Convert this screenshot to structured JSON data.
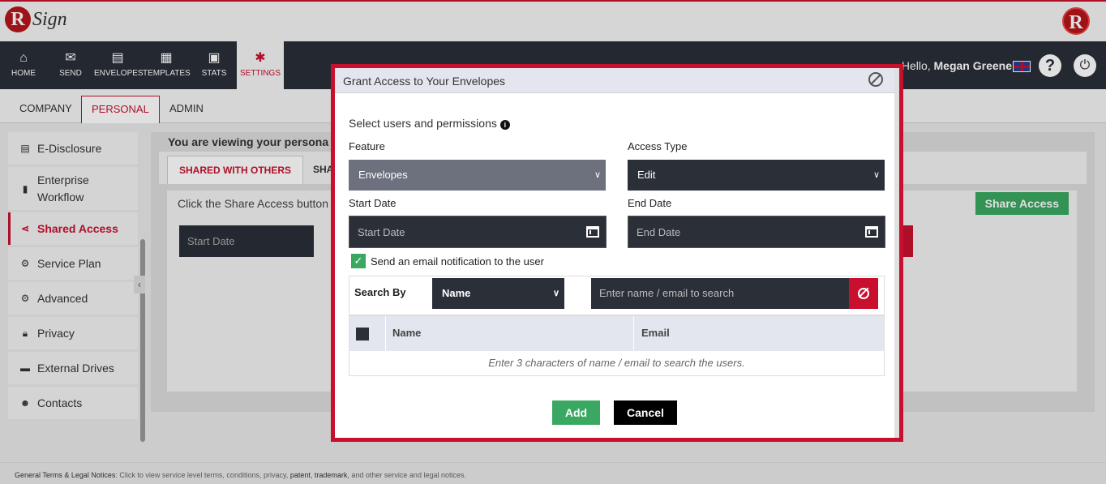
{
  "app": {
    "logo_letter": "R",
    "logo_text": "Sign"
  },
  "nav": {
    "items": [
      {
        "label": "HOME",
        "icon": "home-icon"
      },
      {
        "label": "SEND",
        "icon": "envelope-icon"
      },
      {
        "label": "ENVELOPES",
        "icon": "envelopes-icon"
      },
      {
        "label": "TEMPLATES",
        "icon": "templates-icon"
      },
      {
        "label": "STATS",
        "icon": "briefcase-icon"
      },
      {
        "label": "SETTINGS",
        "icon": "gear-icon"
      }
    ],
    "hello_prefix": "Hello,",
    "user_name": "Megan Greene",
    "help": "?",
    "power": "⏻"
  },
  "subtabs": [
    "COMPANY",
    "PERSONAL",
    "ADMIN"
  ],
  "sidebar": {
    "items": [
      {
        "label": "E-Disclosure",
        "icon": "document-icon"
      },
      {
        "label": "Enterprise Workflow",
        "icon": "file-icon"
      },
      {
        "label": "Shared Access",
        "icon": "share-icon"
      },
      {
        "label": "Service Plan",
        "icon": "cogs-icon"
      },
      {
        "label": "Advanced",
        "icon": "gears-icon"
      },
      {
        "label": "Privacy",
        "icon": "lock-icon"
      },
      {
        "label": "External Drives",
        "icon": "drive-icon"
      },
      {
        "label": "Contacts",
        "icon": "users-icon"
      }
    ]
  },
  "main": {
    "title": "You are viewing your persona",
    "tabs": [
      "SHARED WITH OTHERS",
      "SHA"
    ],
    "info": "Click the Share Access button t",
    "share_button": "Share Access",
    "start_date_placeholder": "Start Date"
  },
  "modal": {
    "title": "Grant Access to Your Envelopes",
    "select_label": "Select users and permissions",
    "feature_label": "Feature",
    "feature_value": "Envelopes",
    "access_type_label": "Access Type",
    "access_type_value": "Edit",
    "start_date_label": "Start Date",
    "start_date_placeholder": "Start Date",
    "end_date_label": "End Date",
    "end_date_placeholder": "End Date",
    "notify_label": "Send an email notification to the user",
    "notify_checked": true,
    "search_by_label": "Search By",
    "search_by_value": "Name",
    "search_placeholder": "Enter name / email to search",
    "table_headers": {
      "name": "Name",
      "email": "Email"
    },
    "table_empty": "Enter 3 characters of name / email to search the users.",
    "add_button": "Add",
    "cancel_button": "Cancel"
  },
  "footer": {
    "lead": "General Terms & Legal Notices",
    "text_1": ": Click to view service level terms, conditions, privacy,",
    "link_patent": "patent",
    "link_trademark": "trademark",
    "text_2": ", and other service and legal notices."
  },
  "colors": {
    "brand": "#c8102e",
    "dark": "#2a2f38",
    "green": "#3aa861"
  }
}
